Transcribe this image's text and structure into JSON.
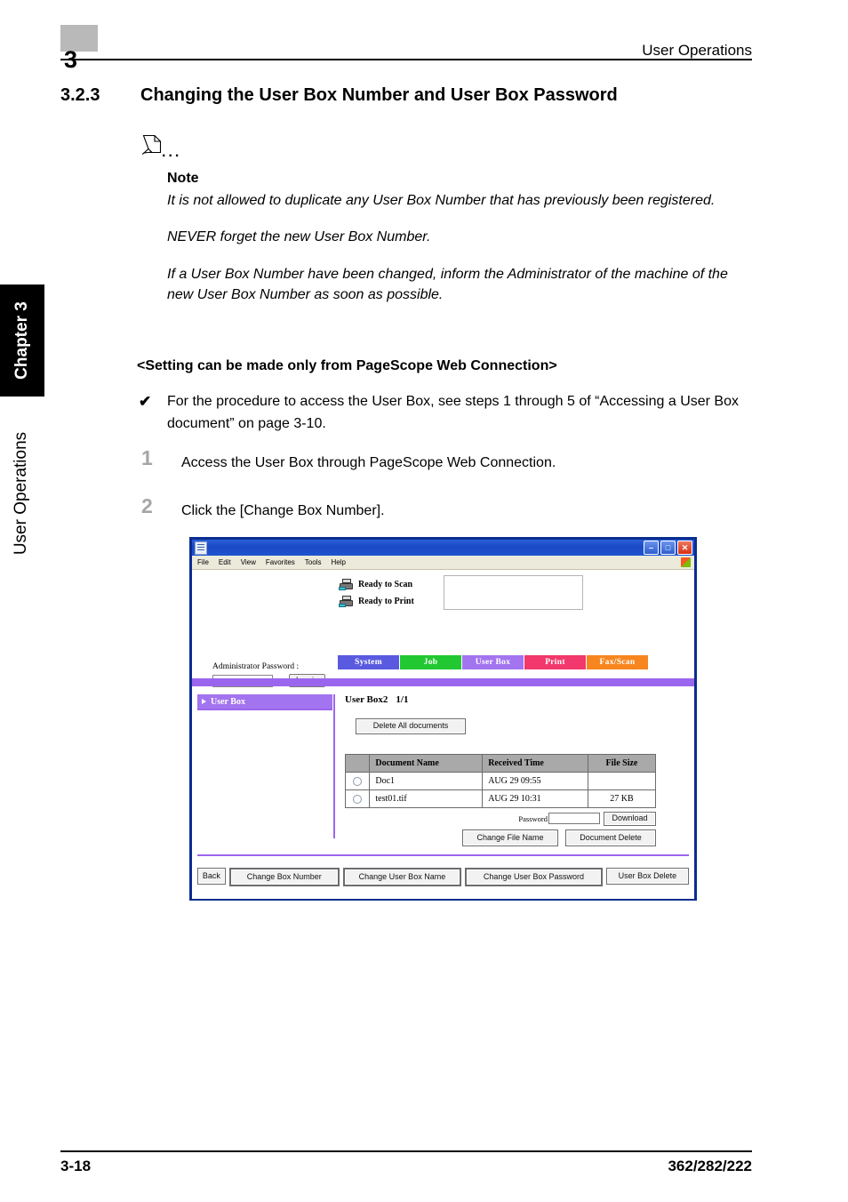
{
  "header": {
    "chapter_number": "3",
    "running_title": "User Operations"
  },
  "section": {
    "number": "3.2.3",
    "title": "Changing the User Box Number and User Box Password"
  },
  "note": {
    "icon": "pencil-icon",
    "dots": "...",
    "label": "Note",
    "paragraphs": [
      "It is not allowed to duplicate any User Box Number that has previously been registered.",
      "NEVER forget the new User Box Number.",
      "If a User Box Number have been changed, inform the Administrator of the machine of the new User Box Number as soon as possible."
    ]
  },
  "setting_heading": "<Setting can be made only from PageScope Web Connection>",
  "check_item": {
    "marker": "✔",
    "text": "For the procedure to access the User Box, see steps 1 through 5 of “Accessing a User Box document” on page 3-10."
  },
  "steps": [
    {
      "number": "1",
      "text": "Access the User Box through PageScope Web Connection."
    },
    {
      "number": "2",
      "text": "Click the [Change Box Number]."
    }
  ],
  "browser": {
    "titlebar": {
      "doc_icon": "document-icon",
      "minimize": "–",
      "maximize": "□",
      "close": "✕"
    },
    "menu": [
      "File",
      "Edit",
      "View",
      "Favorites",
      "Tools",
      "Help"
    ],
    "status": {
      "scan": "Ready to Scan",
      "print": "Ready to Print",
      "message_box_value": ""
    },
    "login": {
      "label": "Administrator Password :",
      "password_value": "",
      "button": "Log-in"
    },
    "tabs": [
      {
        "label": "System",
        "color": "#5a5ae0"
      },
      {
        "label": "Job",
        "color": "#22c832"
      },
      {
        "label": "User Box",
        "color": "#a374ef"
      },
      {
        "label": "Print",
        "color": "#f2386c"
      },
      {
        "label": "Fax/Scan",
        "color": "#f7861f"
      }
    ],
    "sidebar": {
      "items": [
        {
          "label": "User Box"
        }
      ]
    },
    "main": {
      "box_title": "User Box2",
      "page_indicator": "1/1",
      "delete_all_button": "Delete All documents",
      "table": {
        "headers": [
          "",
          "Document Name",
          "Received Time",
          "File Size"
        ],
        "rows": [
          {
            "selected": false,
            "name": "Doc1",
            "time": "AUG 29 09:55",
            "size": ""
          },
          {
            "selected": false,
            "name": "test01.tif",
            "time": "AUG 29 10:31",
            "size": "27 KB"
          }
        ]
      },
      "password_label": "Password",
      "password_value": "",
      "download_button": "Download",
      "change_file_name_button": "Change File Name",
      "document_delete_button": "Document Delete"
    },
    "bottom_buttons": [
      "Back",
      "Change Box Number",
      "Change User Box Name",
      "Change User Box Password",
      "User Box Delete"
    ]
  },
  "side_tabs": {
    "chapter": "Chapter 3",
    "section": "User Operations"
  },
  "footer": {
    "page_number": "3-18",
    "model_numbers": "362/282/222"
  },
  "colors": {
    "chapter_badge": "#b9b9b9",
    "step_number": "#a6a6a6",
    "accent_purple": "#9b66ee",
    "window_border": "#0a2d8f",
    "table_header": "#a9a9a9"
  }
}
